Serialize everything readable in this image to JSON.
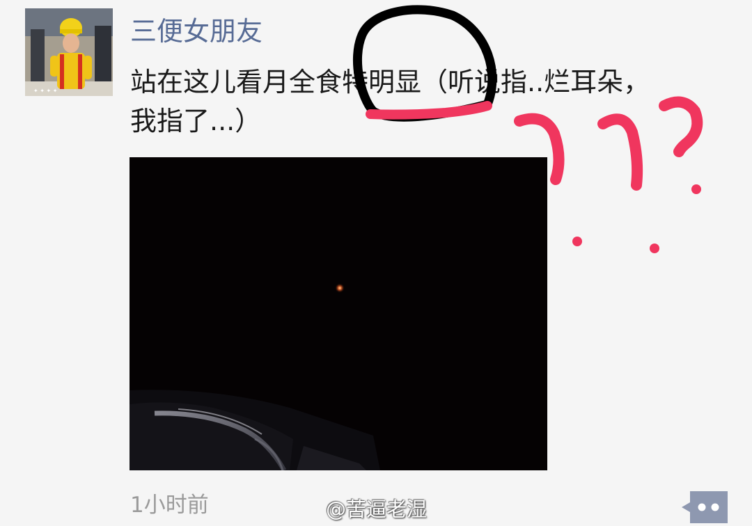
{
  "post": {
    "author": "三便女朋友",
    "text": "站在这儿看月全食特明显（听说指..烂耳朵，我指了...）",
    "time": "1小时前",
    "watermark": "@苦逼老湿",
    "photo_description": "night sky photo with a faint reddish moon and a car roof in the lower-left corner"
  },
  "icons": {
    "comment": "comment-more-icon",
    "avatar": "avatar-image"
  },
  "colors": {
    "name": "#576b95",
    "text": "#1a1a1a",
    "time": "#9a9a9a",
    "background": "#f5f5f5",
    "comment_button": "#8e98b0",
    "annotation_black": "#000000",
    "annotation_red": "#f0365e"
  }
}
